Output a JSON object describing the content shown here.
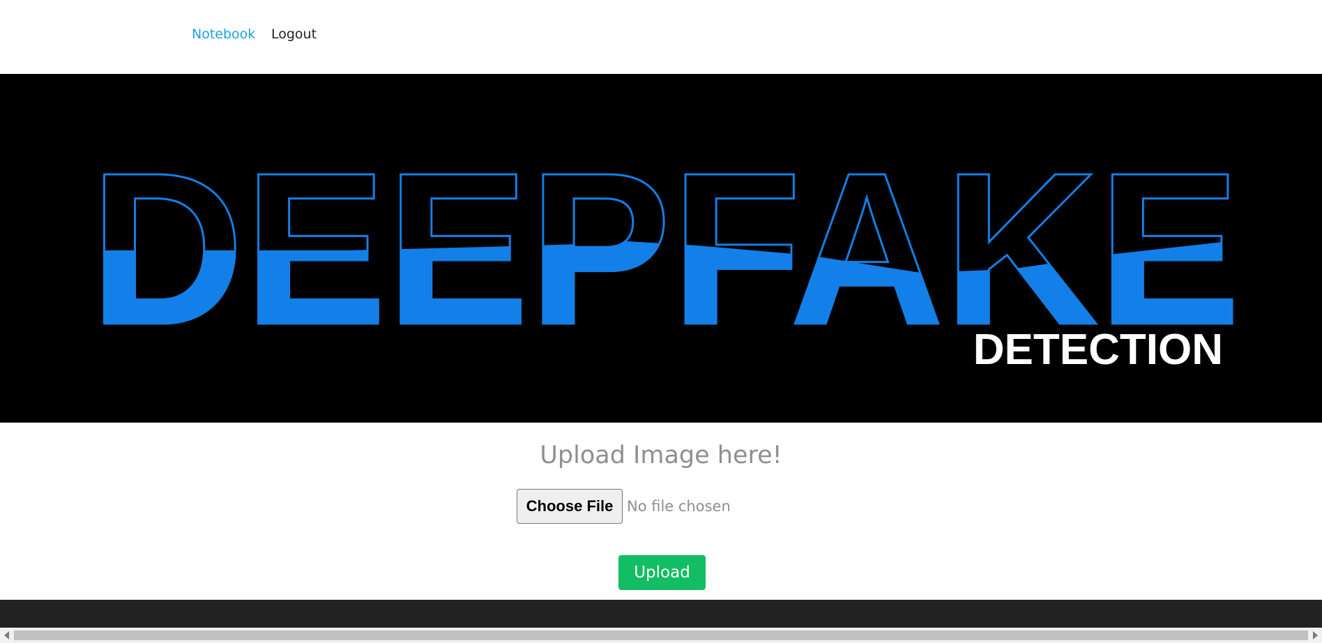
{
  "nav": {
    "items": [
      {
        "label": "Notebook",
        "active": true
      },
      {
        "label": "Logout",
        "active": false
      }
    ],
    "active_color": "#1ba1e2"
  },
  "hero": {
    "logo_word": "DEEPFAKE",
    "logo_subword": "DETECTION",
    "logo_color": "#1280e8",
    "background": "#000000"
  },
  "upload": {
    "heading": "Upload Image here!",
    "choose_label": "Choose File",
    "file_status": "No file chosen",
    "submit_label": "Upload",
    "submit_color": "#13bd63"
  }
}
